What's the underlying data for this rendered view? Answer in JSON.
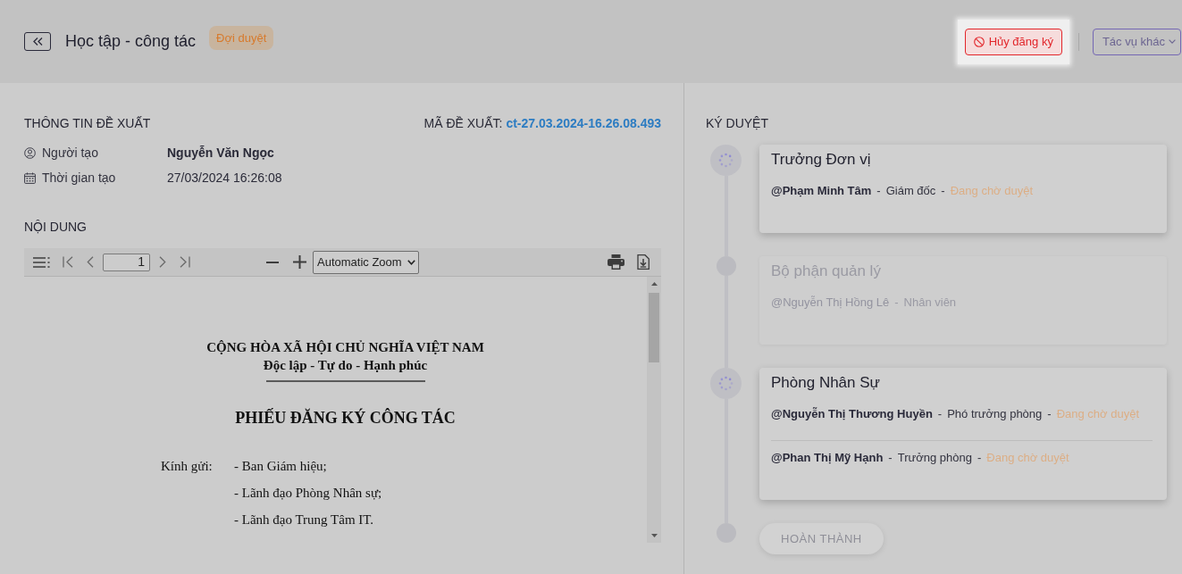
{
  "header": {
    "title": "Học tập - công tác",
    "status_badge": "Đợi duyệt",
    "actions": [
      {
        "kind": "danger",
        "label": "Hủy đăng ký",
        "spotlight": true
      },
      {
        "kind": "dropdown",
        "label": "Tác vụ khác",
        "spotlight": false
      }
    ]
  },
  "proposal": {
    "heading": "THÔNG TIN ĐỀ XUẤT",
    "code_label": "MÃ ĐỀ XUẤT:",
    "code": "ct-27.03.2024-16.26.08.493",
    "fields": [
      {
        "kind": "person",
        "label": "Người tạo",
        "value": "Nguyễn Văn Ngọc"
      },
      {
        "kind": "date",
        "label": "Thời gian tạo",
        "value": "27/03/2024 16:26:08"
      }
    ]
  },
  "content": {
    "heading": "NỘI DUNG",
    "pdf_viewer": {
      "page": "1",
      "zoom": "Automatic Zoom",
      "document": {
        "national_title": "CỘNG HÒA XÃ HỘI CHỦ NGHĨA VIỆT NAM",
        "motto": "Độc lập - Tự do - Hạnh phúc",
        "form_title": "PHIẾU ĐĂNG KÝ CÔNG TÁC",
        "addressee_label": "Kính gửi:",
        "recipients": [
          "- Ban Giám hiệu;",
          "- Lãnh đạo Phòng Nhân sự;",
          "- Lãnh đạo Trung Tâm IT."
        ]
      }
    }
  },
  "approvals": {
    "heading": "KÝ DUYỆT",
    "steps": [
      {
        "title": "Trưởng Đơn vị",
        "active": true,
        "approvers": [
          {
            "parts": [
              {
                "kind": "name",
                "text": "@Phạm Minh Tâm"
              },
              {
                "kind": "separator",
                "text": "-"
              },
              {
                "kind": "role",
                "text": "Giám đốc"
              },
              {
                "kind": "separator",
                "text": "-"
              },
              {
                "kind": "status",
                "text": "Đang chờ duyệt"
              }
            ]
          }
        ]
      },
      {
        "title": "Bộ phận quản lý",
        "active": false,
        "approvers": [
          {
            "parts": [
              {
                "kind": "name",
                "text": "@Nguyễn Thị Hồng Lê"
              },
              {
                "kind": "separator",
                "text": "-"
              },
              {
                "kind": "role",
                "text": "Nhân viên"
              }
            ]
          }
        ]
      },
      {
        "title": "Phòng Nhân Sự",
        "active": true,
        "approvers": [
          {
            "parts": [
              {
                "kind": "name",
                "text": "@Nguyễn Thị Thương Huyền"
              },
              {
                "kind": "separator",
                "text": "-"
              },
              {
                "kind": "role",
                "text": "Phó trưởng phòng"
              },
              {
                "kind": "separator",
                "text": "-"
              },
              {
                "kind": "status",
                "text": "Đang chờ duyệt"
              }
            ]
          },
          {
            "parts": [
              {
                "kind": "name",
                "text": "@Phan Thị Mỹ Hạnh"
              },
              {
                "kind": "separator",
                "text": "-"
              },
              {
                "kind": "role",
                "text": "Trưởng phòng"
              },
              {
                "kind": "separator",
                "text": "-"
              },
              {
                "kind": "status",
                "text": "Đang chờ duyệt"
              }
            ]
          }
        ]
      }
    ],
    "finish": "HOÀN THÀNH"
  }
}
